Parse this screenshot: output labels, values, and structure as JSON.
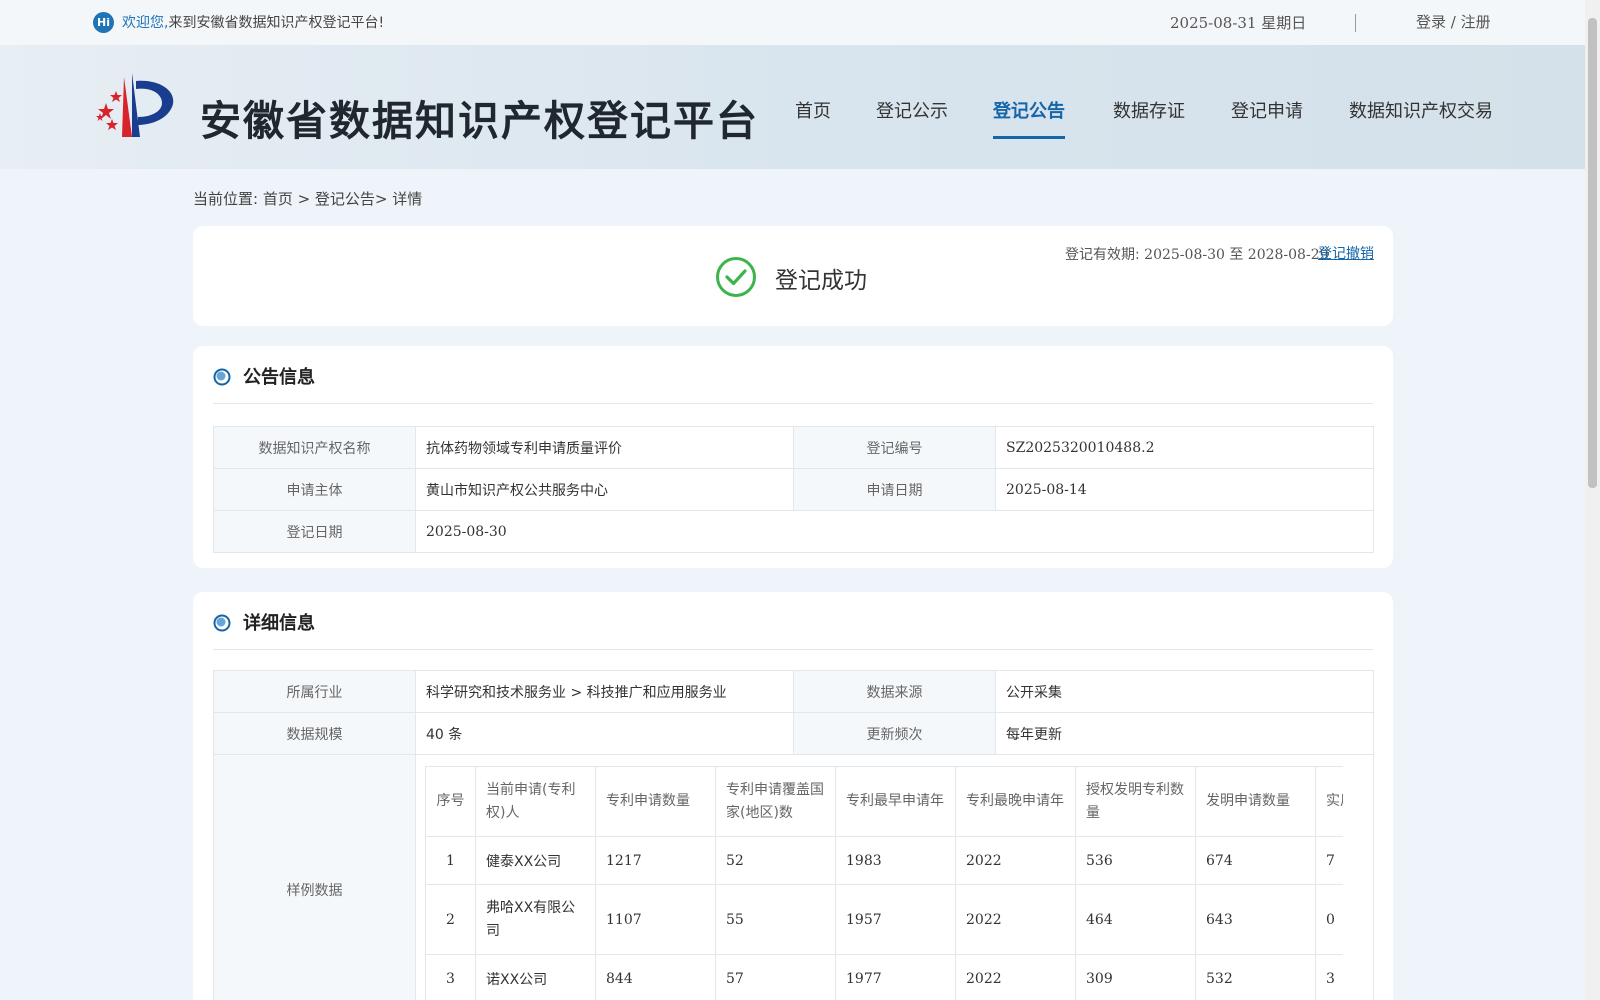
{
  "topbar": {
    "hi_badge": "Hi",
    "welcome_strong": "欢迎您,",
    "welcome_rest": "来到安徽省数据知识产权登记平台!",
    "date": "2025-08-31 星期日",
    "login_register": "登录 / 注册"
  },
  "header": {
    "site_title": "安徽省数据知识产权登记平台",
    "nav": [
      "首页",
      "登记公示",
      "登记公告",
      "数据存证",
      "登记申请",
      "数据知识产权交易"
    ],
    "active_nav": "登记公告"
  },
  "breadcrumb": "当前位置:  首页 > 登记公告> 详情",
  "status": {
    "text": "登记成功",
    "validity_label": "登记有效期:",
    "validity_dates": "2025-08-30 至 2028-08-29",
    "revoke_link": "登记撤销",
    "success_color": "#3bb54a"
  },
  "announcement": {
    "title": "公告信息",
    "name_label": "数据知识产权名称",
    "name_value": "抗体药物领域专利申请质量评价",
    "reg_no_label": "登记编号",
    "reg_no_value": "SZ2025320010488.2",
    "applicant_label": "申请主体",
    "applicant_value": "黄山市知识产权公共服务中心",
    "apply_date_label": "申请日期",
    "apply_date_value": "2025-08-14",
    "reg_date_label": "登记日期",
    "reg_date_value": "2025-08-30"
  },
  "detail": {
    "title": "详细信息",
    "industry_label": "所属行业",
    "industry_value": "科学研究和技术服务业 > 科技推广和应用服务业",
    "source_label": "数据来源",
    "source_value": "公开采集",
    "scale_label": "数据规模",
    "scale_value": "40 条",
    "frequency_label": "更新频次",
    "frequency_value": "每年更新",
    "sample_label": "样例数据",
    "sample_headers": [
      "序号",
      "当前申请(专利权)人",
      "专利申请数量",
      "专利申请覆盖国家(地区)数",
      "专利最早申请年",
      "专利最晚申请年",
      "授权发明专利数量",
      "发明申请数量",
      "实用"
    ],
    "sample_rows": [
      [
        "1",
        "健泰XX公司",
        "1217",
        "52",
        "1983",
        "2022",
        "536",
        "674",
        "7"
      ],
      [
        "2",
        "弗哈XX有限公司",
        "1107",
        "55",
        "1957",
        "2022",
        "464",
        "643",
        "0"
      ],
      [
        "3",
        "诺XX公司",
        "844",
        "57",
        "1977",
        "2022",
        "309",
        "532",
        "3"
      ]
    ]
  }
}
